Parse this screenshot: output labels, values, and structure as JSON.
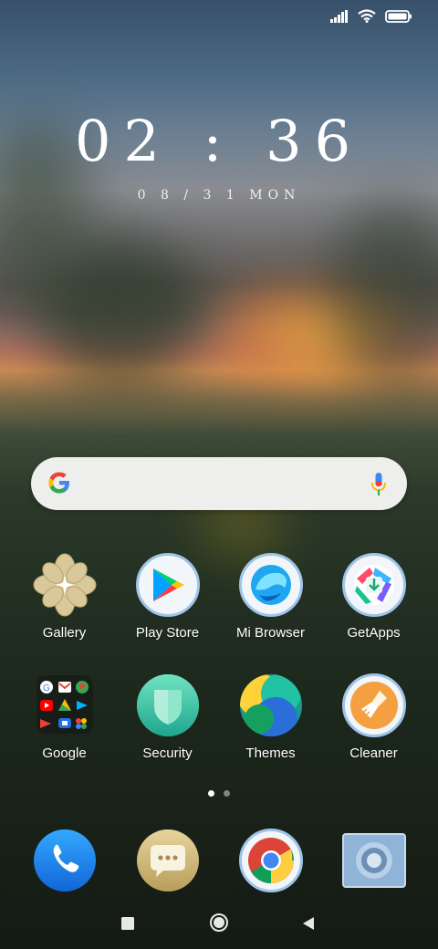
{
  "status_bar": {
    "icons": [
      "signal-icon",
      "wifi-icon",
      "battery-icon"
    ]
  },
  "lockclock": {
    "time": "02 : 36",
    "date": "0 8 / 3 1  MON"
  },
  "search_bar": {
    "logo": "google-g-icon",
    "mic": "mic-icon"
  },
  "apps_row1": [
    {
      "label": "Gallery"
    },
    {
      "label": "Play Store"
    },
    {
      "label": "Mi Browser"
    },
    {
      "label": "GetApps"
    }
  ],
  "apps_row2": [
    {
      "label": "Google"
    },
    {
      "label": "Security"
    },
    {
      "label": "Themes"
    },
    {
      "label": "Cleaner"
    }
  ],
  "page_indicator": {
    "pages": 2,
    "current": 1
  },
  "dock": {
    "items": [
      "phone-icon",
      "messages-icon",
      "chrome-icon",
      "camera-icon"
    ]
  },
  "nav_bar": {
    "buttons": [
      "recents-button",
      "home-button",
      "back-button"
    ]
  },
  "colors": {
    "accent_blue": "#1e88e5",
    "label_white": "#ffffff"
  }
}
